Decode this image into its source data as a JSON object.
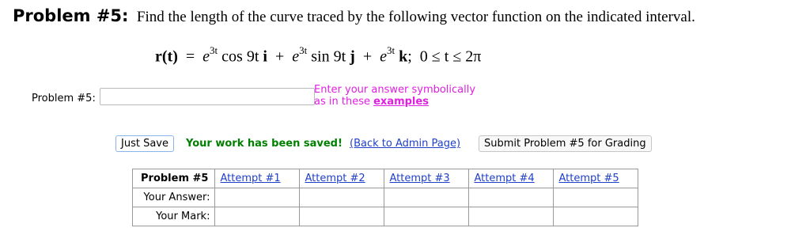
{
  "problem": {
    "title": "Problem #5:",
    "instruction": "Find the length of the curve traced by the following vector function on the indicated interval.",
    "formula": {
      "lhs": "r(t)",
      "exp": "3t",
      "term1": "cos 9t",
      "term2": "sin 9t",
      "unit_i": "i",
      "unit_j": "j",
      "unit_k": "k",
      "interval": "0 ≤ t ≤ 2π"
    }
  },
  "answer": {
    "label": "Problem #5:",
    "value": "",
    "placeholder": "",
    "hint_line1": "Enter your answer symbolically",
    "hint_line2_prefix": "as in these",
    "hint_link": "examples"
  },
  "actions": {
    "just_save": "Just Save",
    "saved_message": "Your work has been saved!",
    "back_link": "(Back to Admin Page)",
    "submit": "Submit Problem #5 for Grading"
  },
  "attempts_table": {
    "corner": "Problem #5",
    "columns": [
      "Attempt #1",
      "Attempt #2",
      "Attempt #3",
      "Attempt #4",
      "Attempt #5"
    ],
    "row_labels": [
      "Your Answer:",
      "Your Mark:"
    ]
  },
  "colors": {
    "hint": "#e020e0",
    "saved": "#008000",
    "link": "#1f40c8"
  }
}
